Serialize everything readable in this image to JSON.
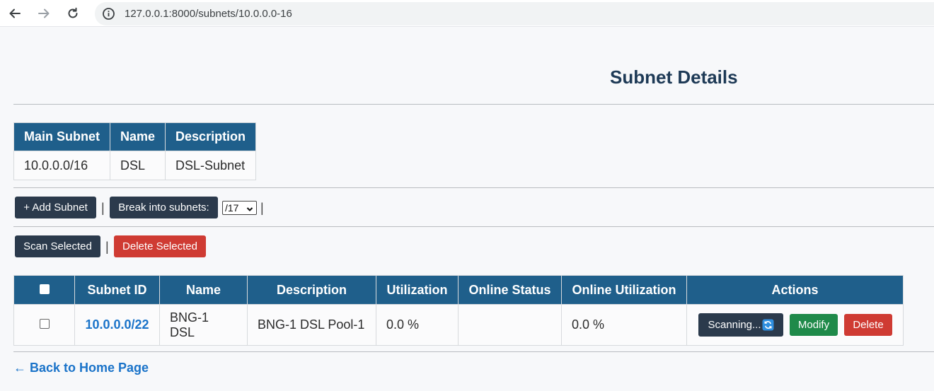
{
  "browser": {
    "url": "127.0.0.1:8000/subnets/10.0.0.0-16"
  },
  "page": {
    "title": "Subnet Details"
  },
  "main_table": {
    "headers": [
      "Main Subnet",
      "Name",
      "Description"
    ],
    "row": [
      "10.0.0.0/16",
      "DSL",
      "DSL-Subnet"
    ]
  },
  "toolbar": {
    "add_subnet_label": "+ Add Subnet",
    "separator": "|",
    "break_label": "Break into subnets:",
    "prefix_select_value": "/17",
    "scan_selected_label": "Scan Selected",
    "delete_selected_label": "Delete Selected"
  },
  "subnets_table": {
    "headers": [
      "",
      "Subnet ID",
      "Name",
      "Description",
      "Utilization",
      "Online Status",
      "Online Utilization",
      "Actions"
    ],
    "rows": [
      {
        "subnet_id": "10.0.0.0/22",
        "name": "BNG-1 DSL",
        "description": "BNG-1 DSL Pool-1",
        "utilization": "0.0 %",
        "online_status": "",
        "online_utilization": "0.0 %",
        "scan_label": "Scanning...",
        "modify_label": "Modify",
        "delete_label": "Delete"
      }
    ]
  },
  "footer": {
    "back_link": "← Back to Home Page"
  },
  "colors": {
    "header_bg": "#1f5f8b",
    "title": "#1e3a56",
    "dark_button": "#2b3a4c",
    "danger": "#cf3b33",
    "success": "#1f8a4a",
    "link": "#1a73c9"
  }
}
